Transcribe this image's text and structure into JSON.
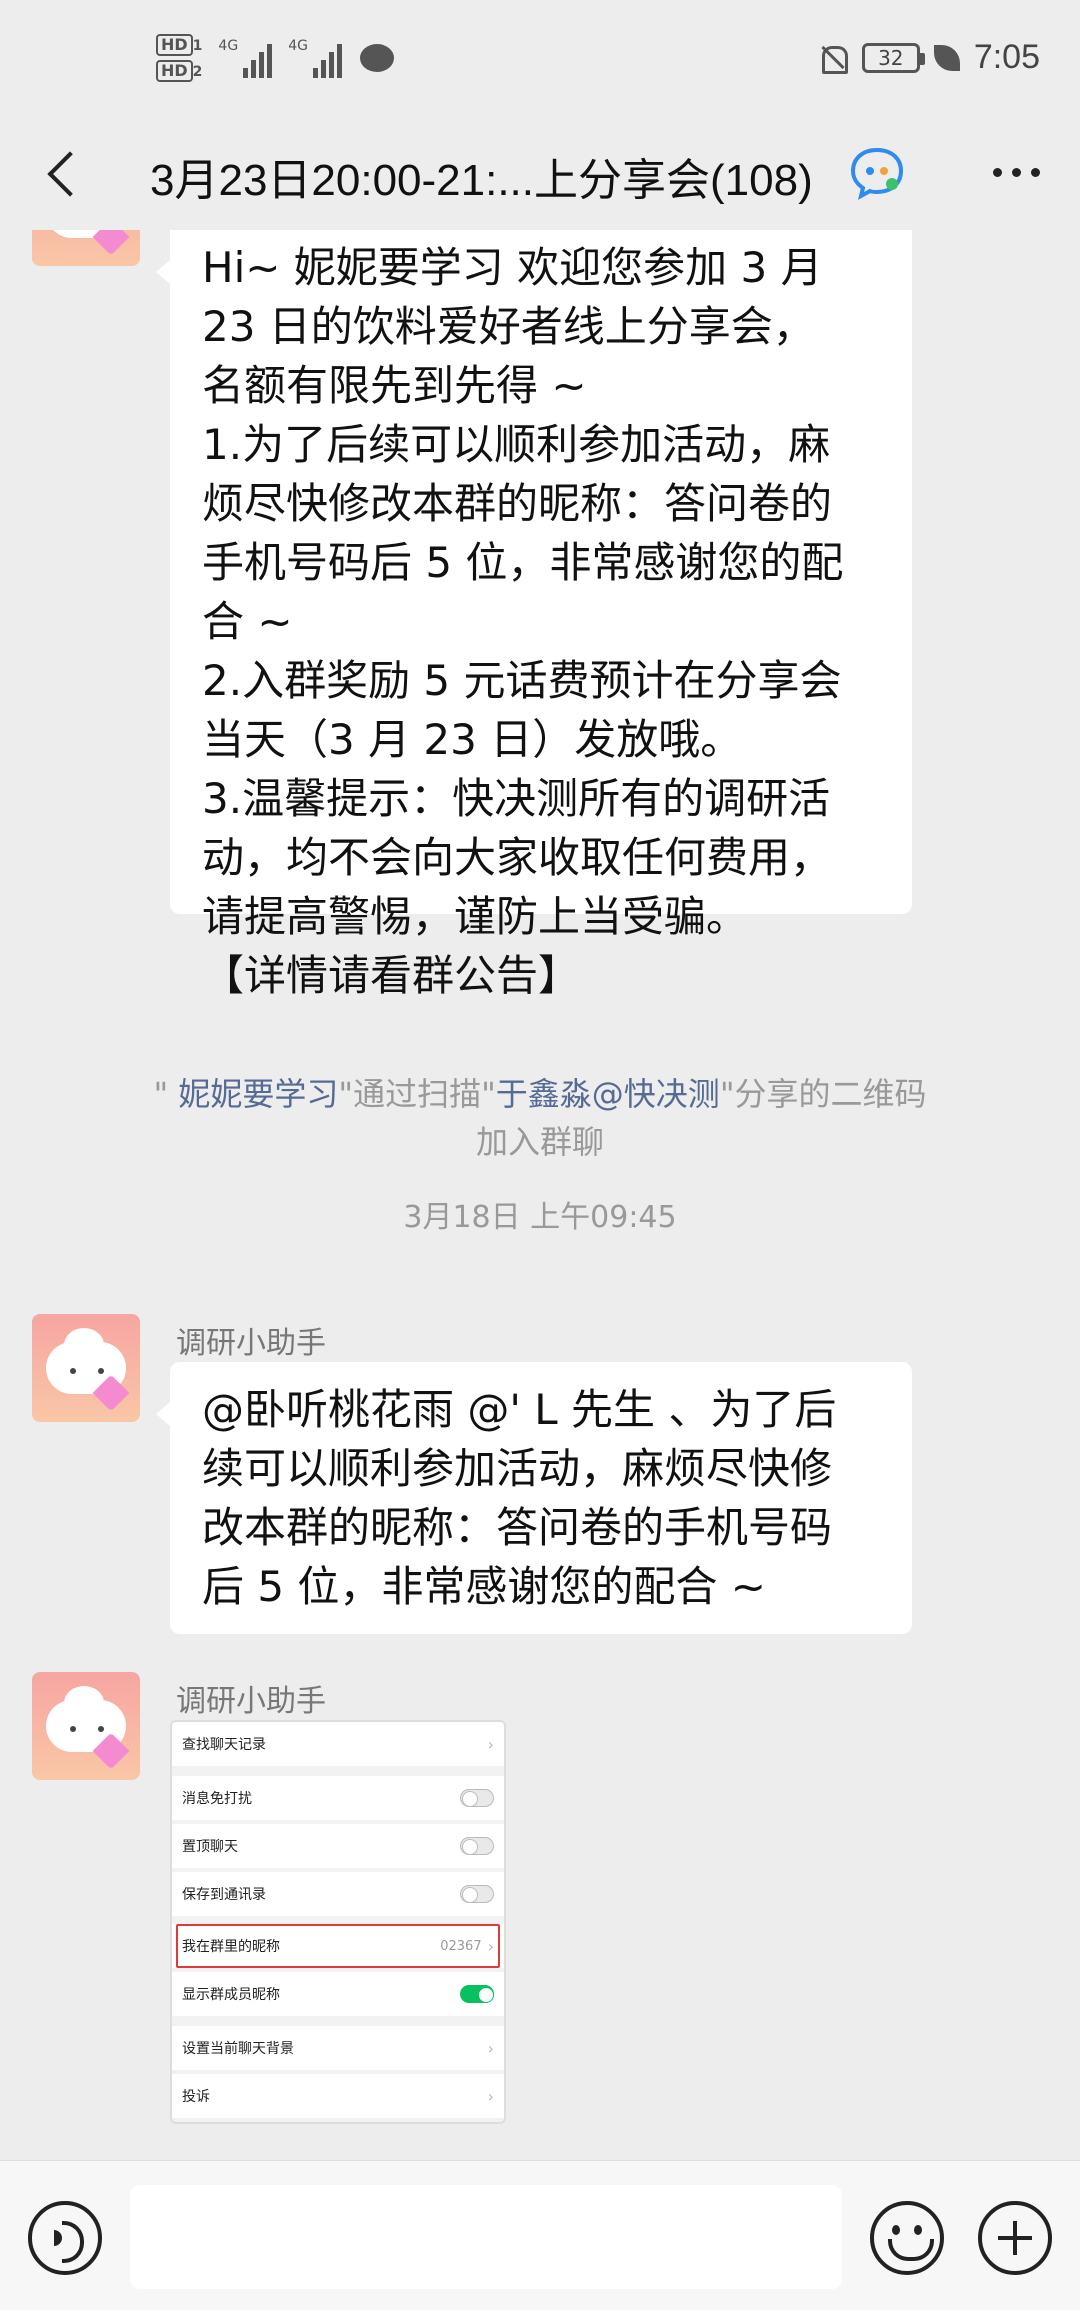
{
  "status_bar": {
    "sim1": "HD",
    "sim1_index": "1",
    "sim2": "HD",
    "sim2_index": "2",
    "net1": "4G",
    "net2": "4G",
    "battery": "32",
    "time": "7:05"
  },
  "header": {
    "title": "3月23日20:00-21:...上分享会(108)"
  },
  "messages": {
    "welcome": {
      "lines": [
        "Hi~ 妮妮要学习 欢迎您参加 3 月",
        "23 日的饮料爱好者线上分享会，",
        "名额有限先到先得 ~",
        "1.为了后续可以顺利参加活动，麻",
        "烦尽快修改本群的昵称：答问卷的",
        "手机号码后 5 位，非常感谢您的配",
        "合 ~",
        "2.入群奖励 5 元话费预计在分享会",
        "当天（3 月 23 日）发放哦。",
        "3.温馨提示：快决测所有的调研活",
        "动，均不会向大家收取任何费用，",
        "请提高警惕，谨防上当受骗。",
        "【详情请看群公告】"
      ]
    },
    "system_join": {
      "q1": "\" ",
      "user": "妮妮要学习",
      "mid1": "\"通过扫描\"",
      "inviter": "于鑫淼@快决测",
      "mid2": "\"分享的二维码",
      "end": "加入群聊"
    },
    "timestamp": "3月18日 上午09:45",
    "sender1": "调研小助手",
    "mention": {
      "lines": [
        "@卧听桃花雨 @' L 先生 、为了后",
        "续可以顺利参加活动，麻烦尽快修",
        "改本群的昵称：答问卷的手机号码",
        "后 5 位，非常感谢您的配合 ~"
      ]
    },
    "sender2": "调研小助手",
    "image": {
      "rows": [
        {
          "label": "查找聊天记录",
          "kind": "chevron"
        },
        {
          "label": "消息免打扰",
          "kind": "toggle-off"
        },
        {
          "label": "置顶聊天",
          "kind": "toggle-off"
        },
        {
          "label": "保存到通讯录",
          "kind": "toggle-off"
        },
        {
          "label": "我在群里的昵称",
          "kind": "value",
          "value": "02367"
        },
        {
          "label": "显示群成员昵称",
          "kind": "toggle-on"
        },
        {
          "label": "设置当前聊天背景",
          "kind": "chevron"
        },
        {
          "label": "投诉",
          "kind": "chevron"
        }
      ],
      "chevron": "›"
    }
  },
  "colors": {
    "background": "#ededed",
    "bubble": "#ffffff",
    "link_name": "#566b94",
    "system_text": "#999999",
    "toggle_on": "#07c160",
    "highlight_box": "#e03a3a"
  }
}
